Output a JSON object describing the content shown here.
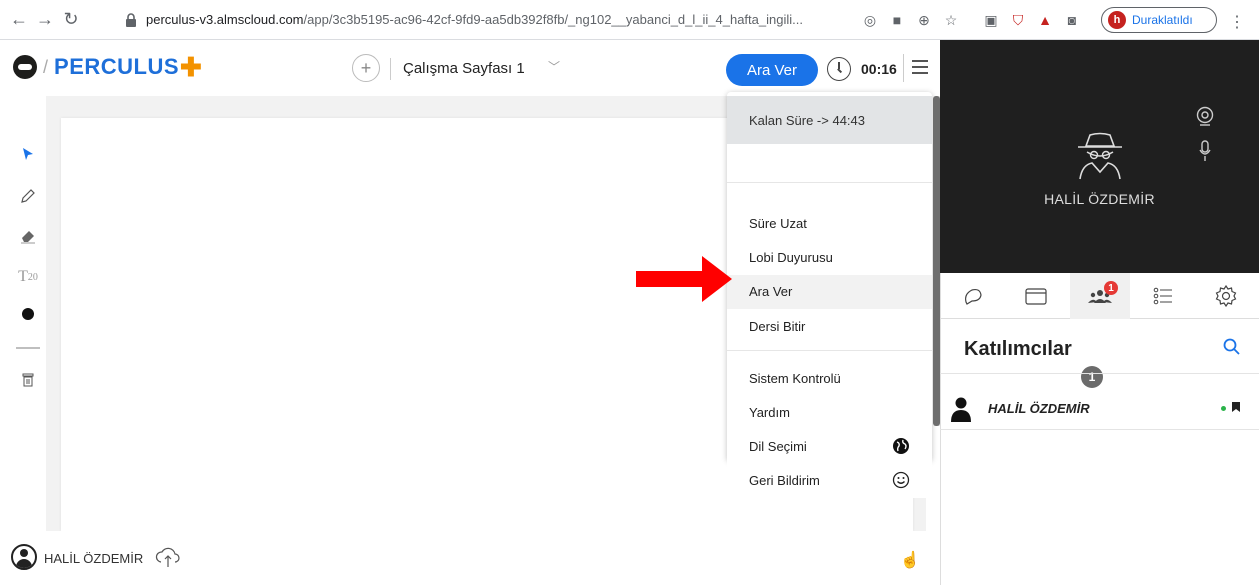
{
  "browser": {
    "url_host": "perculus-v3.almscloud.com",
    "url_path": "/app/3c3b5195-ac96-42cf-9fd9-aa5db392f8fb/_ng102__yabanci_d_l_ii_4_hafta_ingili...",
    "profile_initial": "h",
    "profile_status": "Duraklatıldı"
  },
  "header": {
    "logo_text": "PERCULUS",
    "page_title": "Çalışma Sayfası 1",
    "break_button": "Ara Ver",
    "timer": "00:16"
  },
  "menu": {
    "remaining": "Kalan Süre -> 44:43",
    "items": [
      "Süre Uzat",
      "Lobi Duyurusu",
      "Ara Ver",
      "Dersi Bitir",
      "Sistem Kontrolü",
      "Yardım",
      "Dil Seçimi",
      "Geri Bildirim"
    ]
  },
  "footer": {
    "user_name": "HALİL ÖZDEMİR"
  },
  "video": {
    "name": "HALİL ÖZDEMİR"
  },
  "tabs": {
    "participants_badge": "1"
  },
  "participants": {
    "title": "Katılımcılar",
    "count": "1",
    "list": [
      {
        "name": "HALİL ÖZDEMİR"
      }
    ]
  },
  "colors": {
    "accent": "#1a73e8",
    "brand": "#1e6fd9",
    "plus": "#f39200",
    "arrow": "#ff0000",
    "video_bg": "#1f1f1f",
    "badge": "#e53935"
  }
}
